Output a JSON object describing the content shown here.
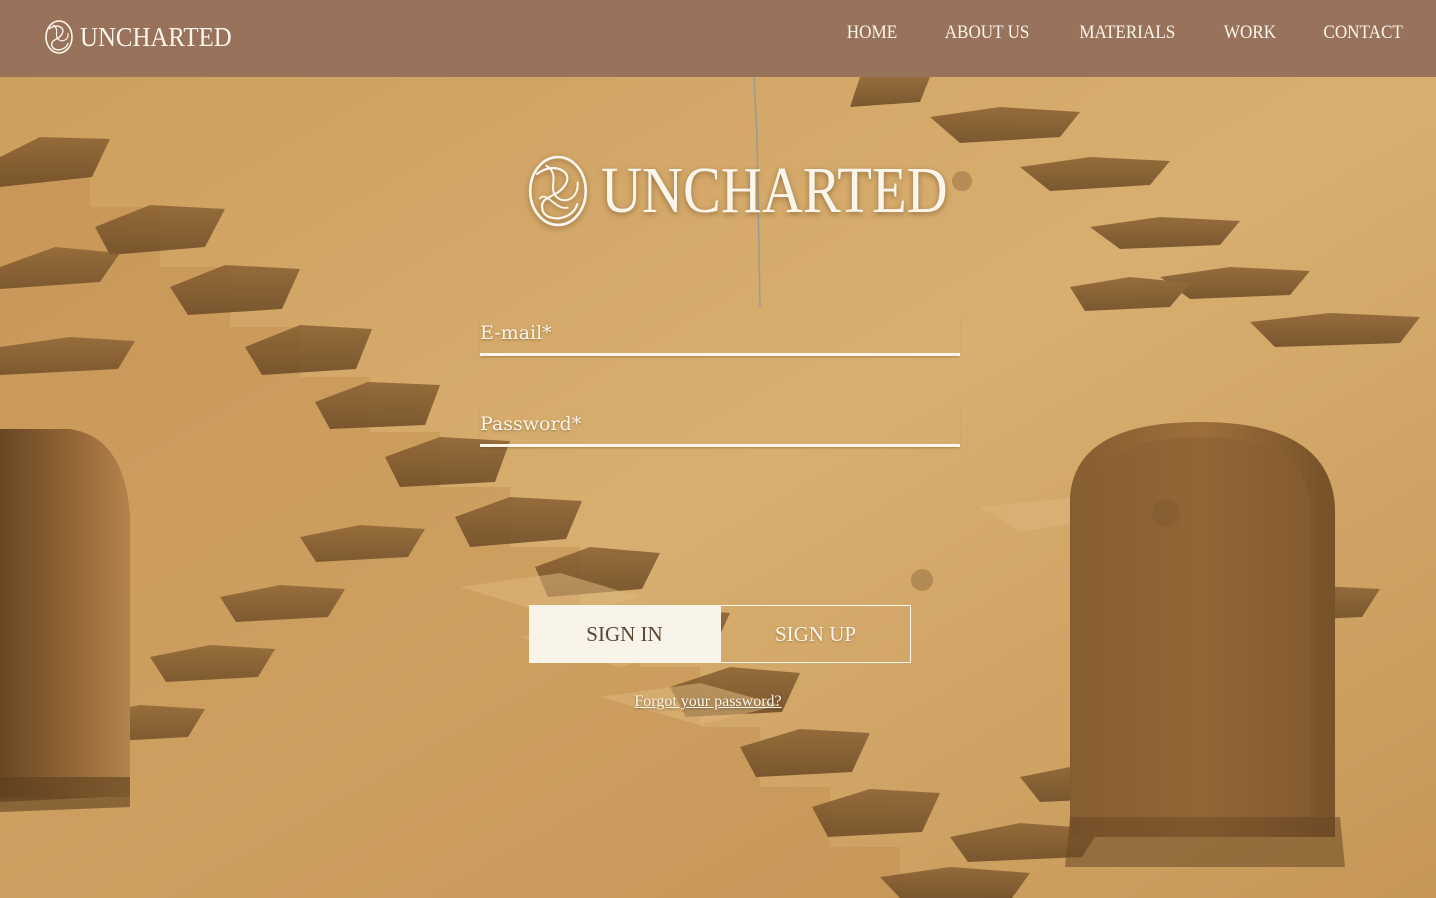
{
  "brand": {
    "name": "UNCHARTED"
  },
  "nav": {
    "items": [
      {
        "label": "HOME"
      },
      {
        "label": "ABOUT US"
      },
      {
        "label": "MATERIALS"
      },
      {
        "label": "WORK"
      },
      {
        "label": "CONTACT"
      }
    ]
  },
  "form": {
    "email_placeholder": "E-mail*",
    "email_value": "",
    "password_placeholder": "Password*",
    "password_value": "",
    "signin_label": "SIGN IN",
    "signup_label": "SIGN UP",
    "forgot_label": "Forgot your password?"
  },
  "colors": {
    "navbar": "#98725a",
    "text": "#fbf6ec",
    "signin_bg": "#f8f4ea",
    "signin_text": "#5b4634",
    "wall": "#d9ad6b"
  },
  "icons": {
    "logo_mark": "swirl-logo-icon"
  }
}
